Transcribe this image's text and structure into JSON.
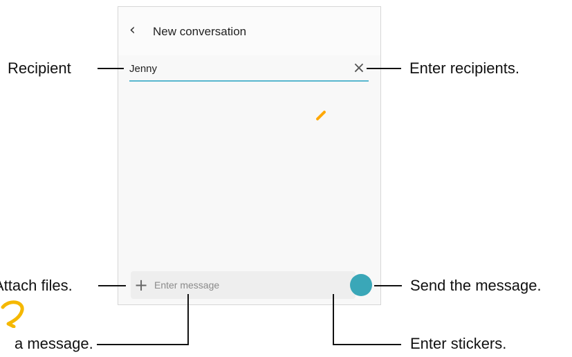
{
  "screen": {
    "title": "New conversation",
    "back_icon": "chevron-left-icon",
    "recipient_value": "Jenny",
    "clear_icon": "close-icon",
    "attach_icon": "plus-icon",
    "message_placeholder": "Enter message",
    "send_icon": "send-icon"
  },
  "callouts": {
    "recipient": "Recipient",
    "enter_recipients": "Enter recipients.",
    "attach_files": "Attach files.",
    "send_message": "Send the message.",
    "enter_message": "a message.",
    "enter_stickers": "Enter stickers."
  },
  "colors": {
    "accent": "#58b7cf",
    "send_button": "#3aa7b8",
    "cursor": "#ffa800",
    "decoration": "#f5b800"
  }
}
